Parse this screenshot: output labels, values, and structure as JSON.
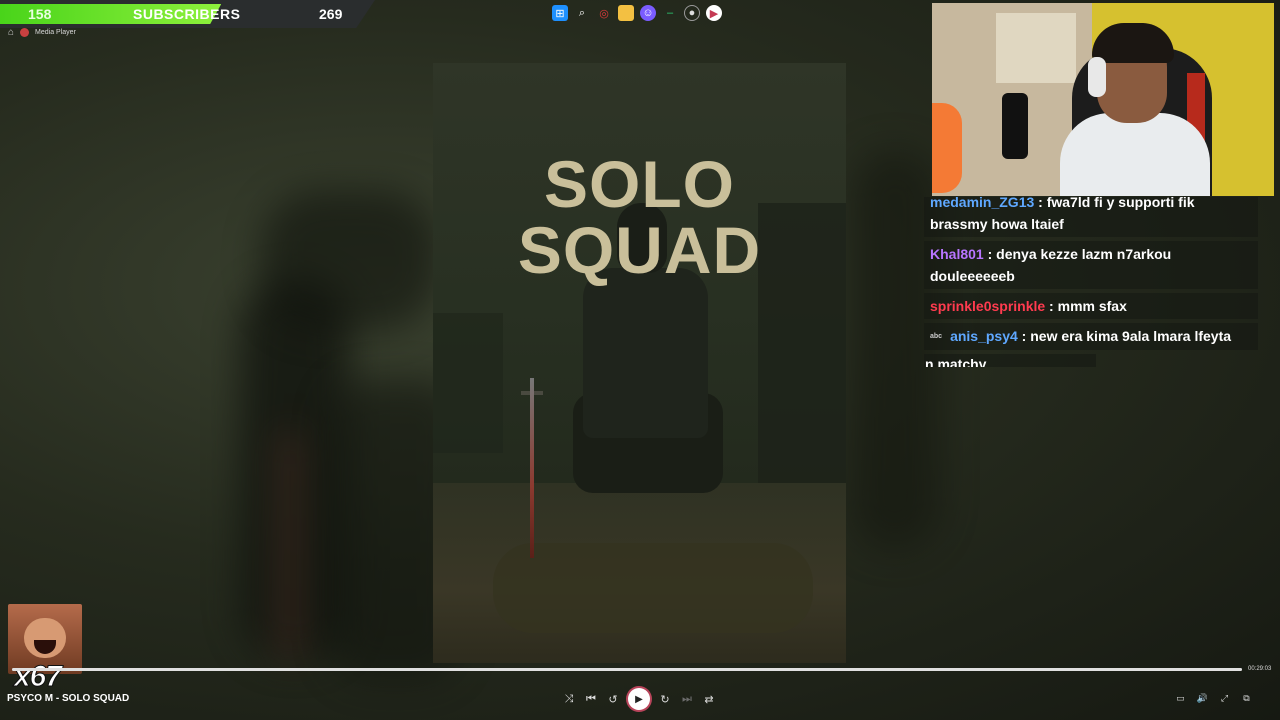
{
  "subscriber_goal": {
    "current": "158",
    "label": "SUBSCRIBERS",
    "goal": "269",
    "progress_fraction": 0.59,
    "colors": {
      "fill": "#49d41a",
      "bar": "#2a2d2e"
    }
  },
  "taskbar": {
    "icons": [
      "windows-icon",
      "search-icon",
      "app-red-icon",
      "folder-icon",
      "discord-icon",
      "app-green-icon",
      "app-record-icon",
      "media-player-icon"
    ]
  },
  "app": {
    "title": "Media Player",
    "home_icon": "home-icon"
  },
  "album_cover": {
    "title": "SOLO SQUAD"
  },
  "chat": {
    "messages": [
      {
        "user": "medamin_ZG13",
        "user_color": "#5fa8ff",
        "text": "fwa7ld fi y supporti fik brassmy howa ltaief",
        "cut_off": true
      },
      {
        "user": "Khal801",
        "user_color": "#b875ff",
        "text": "denya kezze lazm n7arkou douleeeeeeb"
      },
      {
        "user": "sprinkle0sprinkle",
        "user_color": "#ff3b4f",
        "text": "mmm sfax"
      },
      {
        "badge": "abc",
        "user": "anis_psy4",
        "user_color": "#5fa8ff",
        "text": "new era kima 9ala lmara lfeyta"
      }
    ],
    "last_line": "n matchy"
  },
  "emote_counter": {
    "count": "x67",
    "emote_icon": "laughing-man-emote"
  },
  "player": {
    "track": "PSYCO M - SOLO SQUAD",
    "time": "00:29:03",
    "progress_fraction": 1.0,
    "controls": [
      "shuffle-icon",
      "previous-icon",
      "rewind-icon",
      "play-icon",
      "forward-icon",
      "next-icon",
      "repeat-off-icon"
    ],
    "right_controls": [
      "miniplayer-icon",
      "volume-icon",
      "fullscreen-icon",
      "more-icon"
    ],
    "accent": "#b8445a"
  }
}
